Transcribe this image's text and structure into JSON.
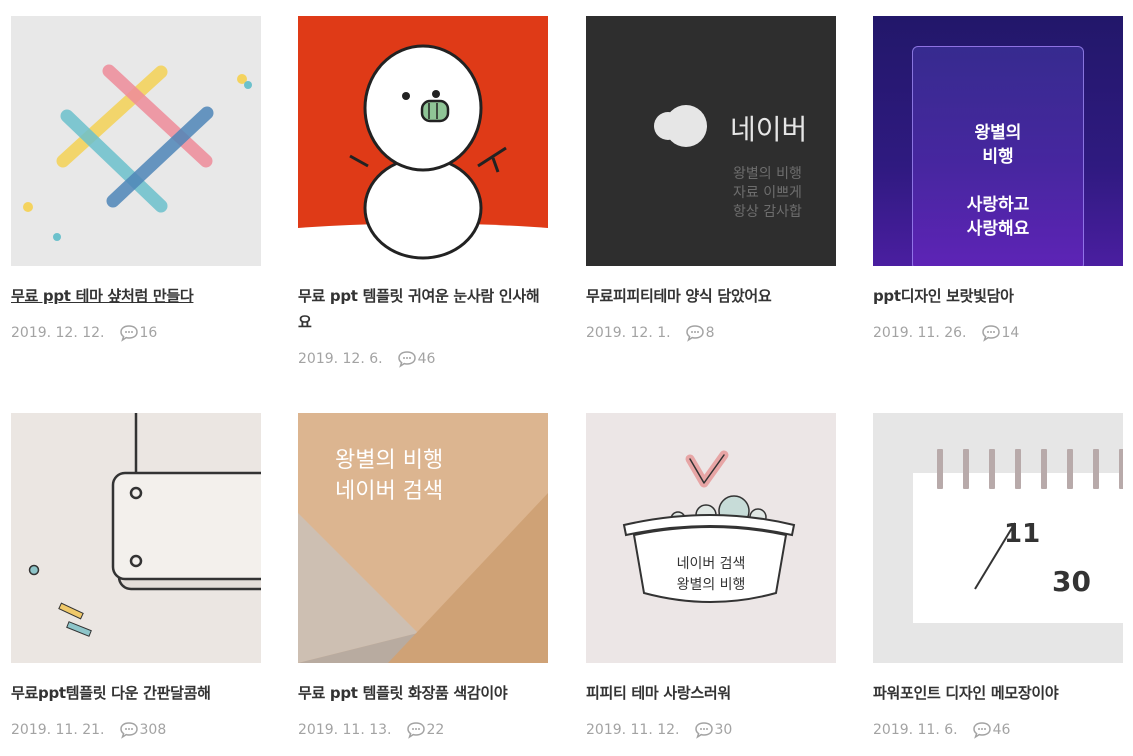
{
  "posts": [
    {
      "title": "무료 ppt 테마 샾처럼 만들다",
      "date": "2019. 12. 12.",
      "comments": "16"
    },
    {
      "title": "무료 ppt 템플릿 귀여운 눈사람 인사해요",
      "date": "2019. 12. 6.",
      "comments": "46"
    },
    {
      "title": "무료피피티테마 양식 담았어요",
      "date": "2019. 12. 1.",
      "comments": "8"
    },
    {
      "title": "ppt디자인 보랏빛담아",
      "date": "2019. 11. 26.",
      "comments": "14"
    },
    {
      "title": "무료ppt템플릿 다운 간판달콤해",
      "date": "2019. 11. 21.",
      "comments": "308"
    },
    {
      "title": "무료 ppt 템플릿 화장품 색감이야",
      "date": "2019. 11. 13.",
      "comments": "22"
    },
    {
      "title": "피피티 테마 사랑스러워",
      "date": "2019. 11. 12.",
      "comments": "30"
    },
    {
      "title": "파워포인트 디자인 메모장이야",
      "date": "2019. 11. 6.",
      "comments": "46"
    }
  ],
  "thumbs": {
    "naver": {
      "logo": "네이버",
      "line1": "왕별의 비행",
      "line2": "자료 이쁘게",
      "line3": "항상 감사합"
    },
    "purple": {
      "line1": "왕별의",
      "line2": "비행",
      "line3": "사랑하고",
      "line4": "사랑해요"
    },
    "beige": {
      "line1": "왕별의 비행",
      "line2": "네이버 검색"
    },
    "basket": {
      "line1": "네이버 검색",
      "line2": "왕별의 비행"
    },
    "calendar": {
      "top": "11",
      "bottom": "30"
    }
  },
  "colors": {
    "title": "#333333",
    "meta": "#a3a3a3",
    "snowman_bg": "#df3a17",
    "naver_bg": "#2e2e2e",
    "purple_bg": "#2a1a72",
    "beige_bg": "#dcb590"
  }
}
